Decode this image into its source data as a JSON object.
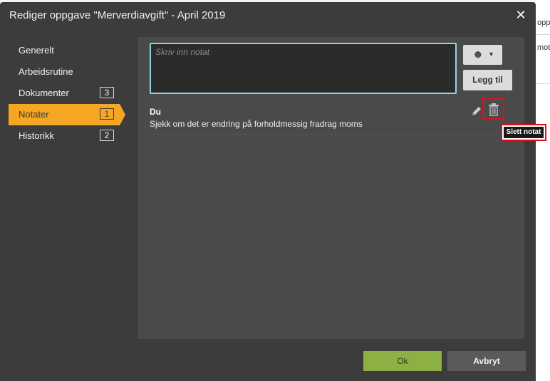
{
  "dialog": {
    "title": "Rediger oppgave \"Merverdiavgift\" - April 2019",
    "close_label": "✕"
  },
  "sidebar": {
    "items": [
      {
        "label": "Generelt",
        "count": null,
        "active": false
      },
      {
        "label": "Arbeidsrutine",
        "count": null,
        "active": false
      },
      {
        "label": "Dokumenter",
        "count": "3",
        "active": false
      },
      {
        "label": "Notater",
        "count": "1",
        "active": true
      },
      {
        "label": "Historikk",
        "count": "2",
        "active": false
      }
    ]
  },
  "notes": {
    "input_placeholder": "Skriv inn notat",
    "input_value": "",
    "emoji_icon": "smiley-icon",
    "emoji_glyph": "☻",
    "add_label": "Legg til",
    "list": [
      {
        "author": "Du",
        "text": "Sjekk om det er endring på forholdmessig fradrag moms"
      }
    ],
    "delete_tooltip": "Slett notat"
  },
  "footer": {
    "ok_label": "Ok",
    "cancel_label": "Avbryt"
  },
  "background": {
    "fragments": [
      "opp",
      "mot"
    ]
  },
  "colors": {
    "dialog_bg": "#3c3c3c",
    "panel_bg": "#4a4a4a",
    "active_nav": "#f5a623",
    "ok_button": "#8cb043",
    "highlight": "#e0101a",
    "input_border": "#8fd3e8"
  }
}
